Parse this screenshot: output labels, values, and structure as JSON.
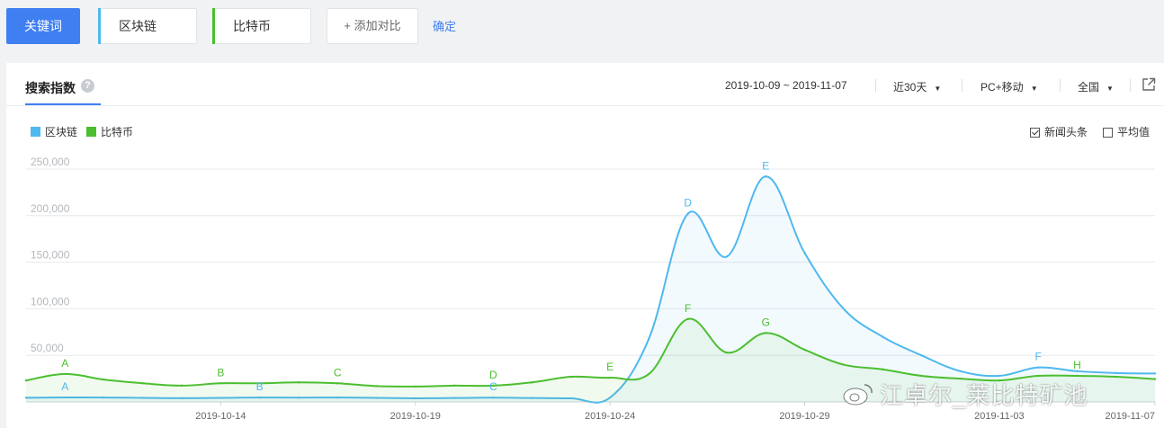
{
  "toolbar": {
    "keyword_button": "关键词",
    "keywords": [
      {
        "label": "区块链",
        "color": "#4fb8ee"
      },
      {
        "label": "比特币",
        "color": "#4bbf2f"
      }
    ],
    "add_compare": "+ 添加对比",
    "confirm": "确定"
  },
  "panel": {
    "tab_title": "搜索指数",
    "help_icon": "question-icon",
    "date_range": "2019-10-09 ~ 2019-11-07",
    "period": "近30天",
    "device": "PC+移动",
    "region": "全国",
    "share_icon": "external-link-icon",
    "options": {
      "news_headlines": {
        "label": "新闻头条",
        "checked": true
      },
      "average": {
        "label": "平均值",
        "checked": false
      }
    }
  },
  "watermark": {
    "text": "江卓尔_莱比特矿池",
    "icon": "weibo-icon"
  },
  "chart_data": {
    "type": "area",
    "x": [
      "2019-10-09",
      "2019-10-10",
      "2019-10-11",
      "2019-10-12",
      "2019-10-13",
      "2019-10-14",
      "2019-10-15",
      "2019-10-16",
      "2019-10-17",
      "2019-10-18",
      "2019-10-19",
      "2019-10-20",
      "2019-10-21",
      "2019-10-22",
      "2019-10-23",
      "2019-10-24",
      "2019-10-25",
      "2019-10-26",
      "2019-10-27",
      "2019-10-28",
      "2019-10-29",
      "2019-10-30",
      "2019-10-31",
      "2019-11-01",
      "2019-11-02",
      "2019-11-03",
      "2019-11-04",
      "2019-11-05",
      "2019-11-06",
      "2019-11-07"
    ],
    "x_tick_labels": [
      "2019-10-14",
      "2019-10-19",
      "2019-10-24",
      "2019-10-29",
      "2019-11-03",
      "2019-11-07"
    ],
    "y_tick_labels": [
      "50,000",
      "100,000",
      "150,000",
      "200,000",
      "250,000"
    ],
    "ylim": [
      0,
      260000
    ],
    "grid": true,
    "legend_position": "top-left",
    "series": [
      {
        "name": "区块链",
        "color": "#4fb8ee",
        "values": [
          4500,
          4800,
          4700,
          4400,
          4000,
          4300,
          4700,
          4600,
          4700,
          4300,
          3900,
          4200,
          4600,
          4200,
          3900,
          4600,
          68000,
          202000,
          156000,
          242000,
          160000,
          100000,
          70000,
          50000,
          33000,
          28000,
          37000,
          33000,
          31000,
          30500
        ]
      },
      {
        "name": "比特币",
        "color": "#4bbf2f",
        "values": [
          23000,
          30000,
          24000,
          20000,
          17500,
          20000,
          20000,
          21000,
          20000,
          17000,
          16500,
          17500,
          17500,
          21000,
          27000,
          26000,
          30000,
          89000,
          53000,
          74000,
          56000,
          40000,
          35000,
          28000,
          25000,
          23000,
          28000,
          28000,
          27000,
          24500
        ]
      }
    ],
    "annotations": [
      {
        "series": "区块链",
        "label": "A",
        "x_index": 1
      },
      {
        "series": "区块链",
        "label": "B",
        "x_index": 6
      },
      {
        "series": "区块链",
        "label": "C",
        "x_index": 12
      },
      {
        "series": "区块链",
        "label": "D",
        "x_index": 17
      },
      {
        "series": "区块链",
        "label": "E",
        "x_index": 19
      },
      {
        "series": "区块链",
        "label": "F",
        "x_index": 26
      },
      {
        "series": "比特币",
        "label": "A",
        "x_index": 1
      },
      {
        "series": "比特币",
        "label": "B",
        "x_index": 5
      },
      {
        "series": "比特币",
        "label": "C",
        "x_index": 8
      },
      {
        "series": "比特币",
        "label": "D",
        "x_index": 12
      },
      {
        "series": "比特币",
        "label": "E",
        "x_index": 15
      },
      {
        "series": "比特币",
        "label": "F",
        "x_index": 17
      },
      {
        "series": "比特币",
        "label": "G",
        "x_index": 19
      },
      {
        "series": "比特币",
        "label": "H",
        "x_index": 27
      }
    ]
  }
}
